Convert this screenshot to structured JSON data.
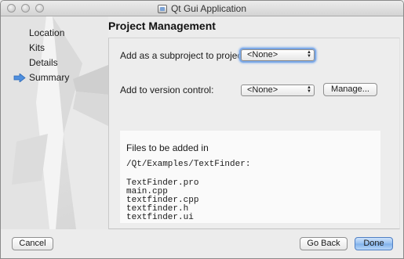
{
  "window": {
    "title": "Qt Gui Application"
  },
  "sidebar": {
    "items": [
      {
        "label": "Location",
        "current": false
      },
      {
        "label": "Kits",
        "current": false
      },
      {
        "label": "Details",
        "current": false
      },
      {
        "label": "Summary",
        "current": true
      }
    ]
  },
  "page": {
    "title": "Project Management",
    "subproject_label": "Add as a subproject to project:",
    "subproject_value": "<None>",
    "vcs_label": "Add to version control:",
    "vcs_value": "<None>",
    "manage_label": "Manage..."
  },
  "files": {
    "heading": "Files to be added in",
    "directory": "/Qt/Examples/TextFinder:",
    "items": [
      "TextFinder.pro",
      "main.cpp",
      "textfinder.cpp",
      "textfinder.h",
      "textfinder.ui"
    ]
  },
  "footer": {
    "cancel_label": "Cancel",
    "back_label": "Go Back",
    "done_label": "Done"
  },
  "colors": {
    "focus_ring": "#7ca8e6",
    "current_arrow": "#4f8fde",
    "default_button": "#94bff0"
  },
  "icons": {
    "current_page": "arrow-right-icon",
    "window_app": "qt-app-icon"
  }
}
